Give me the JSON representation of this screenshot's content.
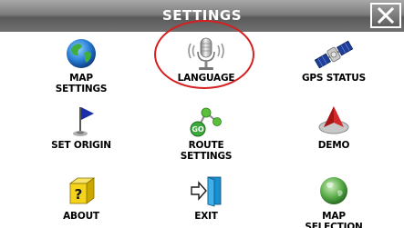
{
  "titlebar": {
    "title": "SETTINGS",
    "close_symbol": "✕"
  },
  "menu": {
    "items": [
      {
        "label": "MAP\nSETTINGS",
        "icon": "globe-icon"
      },
      {
        "label": "LANGUAGE",
        "icon": "microphone-icon"
      },
      {
        "label": "GPS STATUS",
        "icon": "satellite-icon"
      },
      {
        "label": "SET ORIGIN",
        "icon": "flag-icon"
      },
      {
        "label": "ROUTE\nSETTINGS",
        "icon": "route-icon"
      },
      {
        "label": "DEMO",
        "icon": "compass-icon"
      },
      {
        "label": "ABOUT",
        "icon": "question-icon"
      },
      {
        "label": "EXIT",
        "icon": "exit-door-icon"
      },
      {
        "label": "MAP\nSELECTION",
        "icon": "map-selection-icon"
      }
    ],
    "route_badge": "GO",
    "about_badge": "?"
  },
  "colors": {
    "highlight": "#d42020",
    "titlebar": "#7d7d7d",
    "globe": "#2a7fd6",
    "flag": "#1a2ea8",
    "green": "#3aa83a"
  }
}
